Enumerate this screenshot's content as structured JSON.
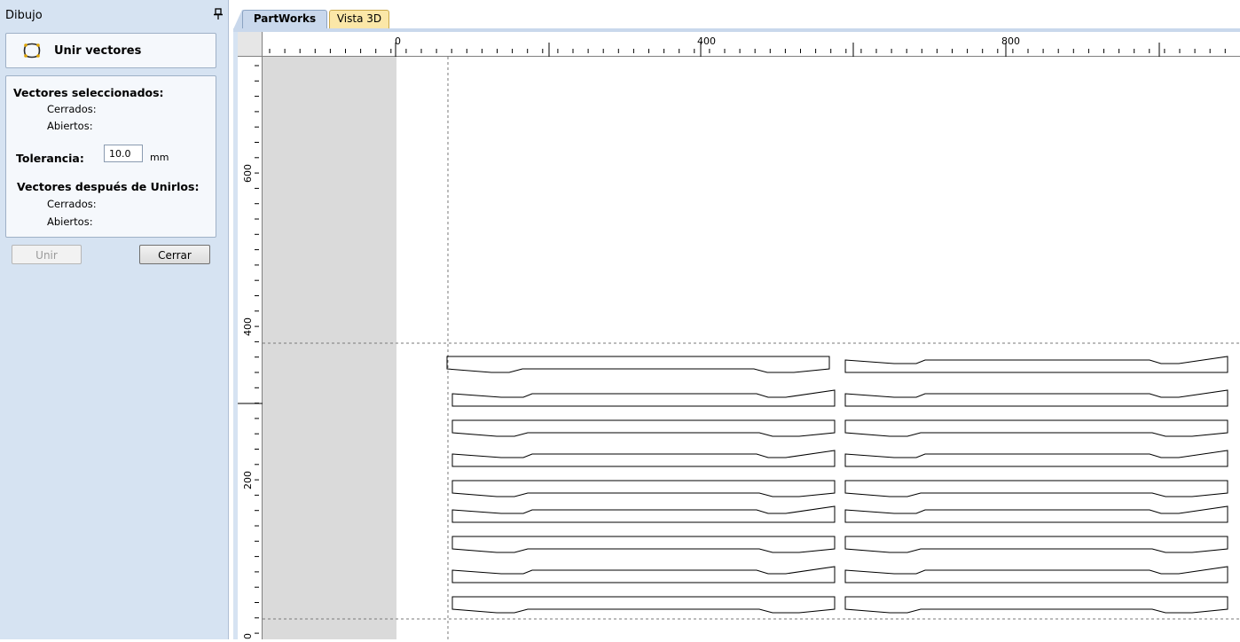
{
  "panel": {
    "title": "Dibujo",
    "pin_icon": "pin-icon",
    "tool_icon": "join-vectors-icon",
    "tool_title": "Unir vectores",
    "selected_heading": "Vectores seleccionados:",
    "closed_label": "Cerrados:",
    "open_label": "Abiertos:",
    "tolerance_label": "Tolerancia:",
    "tolerance_value": "10.0",
    "tolerance_unit": "mm",
    "after_heading": "Vectores después de Unirlos:",
    "after_closed_label": "Cerrados:",
    "after_open_label": "Abiertos:",
    "join_button": "Unir",
    "close_button": "Cerrar"
  },
  "tabs": [
    {
      "label": "PartWorks",
      "active": true
    },
    {
      "label": "Vista 3D",
      "active": false
    }
  ],
  "ruler": {
    "h_labels": [
      "0",
      "400",
      "800"
    ],
    "v_labels": [
      "600",
      "400",
      "200",
      "0"
    ]
  },
  "colors": {
    "panel_bg": "#d6e3f2",
    "tab_active": "#c9d8ec",
    "tab_3d": "#fbe7a8",
    "outside_material": "#dadada"
  },
  "cursor_icon": "mouse-pointer-icon"
}
